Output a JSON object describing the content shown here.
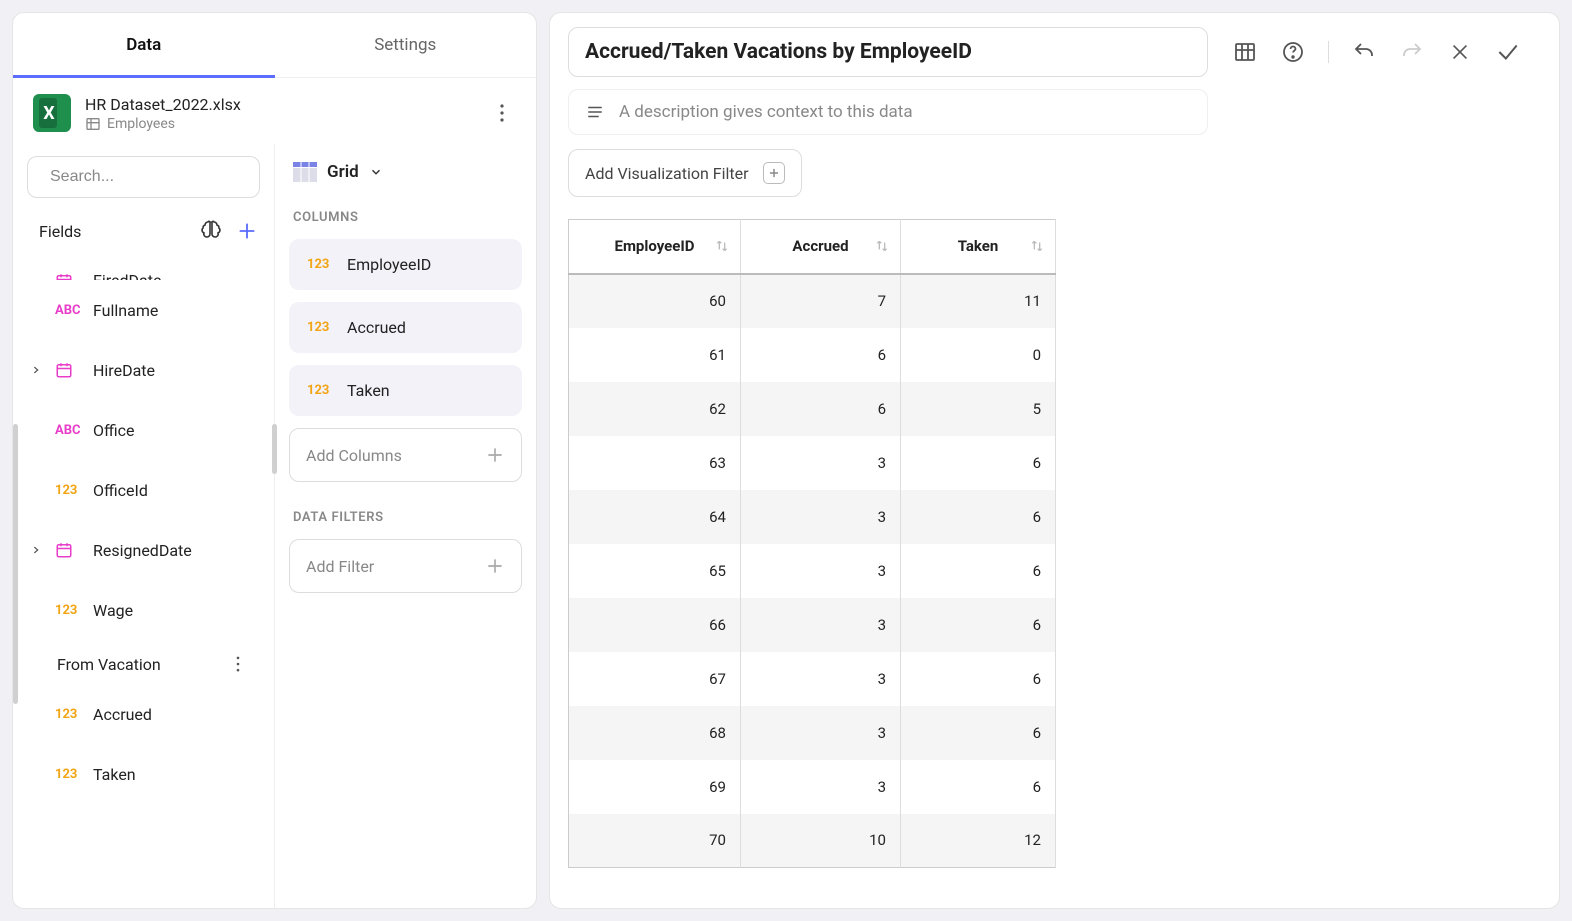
{
  "tabs": {
    "data": "Data",
    "settings": "Settings"
  },
  "datasource": {
    "title": "HR Dataset_2022.xlsx",
    "sheet": "Employees"
  },
  "search": {
    "placeholder": "Search..."
  },
  "fields": {
    "label": "Fields",
    "items": [
      {
        "name": "FiredDate",
        "type": "date",
        "expandable": true,
        "cutoff": true
      },
      {
        "name": "Fullname",
        "type": "abc",
        "expandable": false
      },
      {
        "name": "HireDate",
        "type": "date",
        "expandable": true
      },
      {
        "name": "Office",
        "type": "abc",
        "expandable": false
      },
      {
        "name": "OfficeId",
        "type": "123",
        "expandable": false
      },
      {
        "name": "ResignedDate",
        "type": "date",
        "expandable": true
      },
      {
        "name": "Wage",
        "type": "123",
        "expandable": false
      }
    ],
    "group2_label": "From Vacation",
    "group2_items": [
      {
        "name": "Accrued",
        "type": "123"
      },
      {
        "name": "Taken",
        "type": "123"
      }
    ]
  },
  "config": {
    "viz_label": "Grid",
    "columns_label": "COLUMNS",
    "columns": [
      {
        "name": "EmployeeID",
        "type": "123"
      },
      {
        "name": "Accrued",
        "type": "123"
      },
      {
        "name": "Taken",
        "type": "123"
      }
    ],
    "add_columns": "Add Columns",
    "filters_label": "DATA FILTERS",
    "add_filter": "Add Filter"
  },
  "viz": {
    "title": "Accrued/Taken Vacations by EmployeeID",
    "desc_placeholder": "A description gives context to this data",
    "filter_btn": "Add Visualization Filter",
    "headers": {
      "c1": "EmployeeID",
      "c2": "Accrued",
      "c3": "Taken"
    },
    "rows": [
      {
        "eid": "60",
        "acc": "7",
        "tak": "11"
      },
      {
        "eid": "61",
        "acc": "6",
        "tak": "0"
      },
      {
        "eid": "62",
        "acc": "6",
        "tak": "5"
      },
      {
        "eid": "63",
        "acc": "3",
        "tak": "6"
      },
      {
        "eid": "64",
        "acc": "3",
        "tak": "6"
      },
      {
        "eid": "65",
        "acc": "3",
        "tak": "6"
      },
      {
        "eid": "66",
        "acc": "3",
        "tak": "6"
      },
      {
        "eid": "67",
        "acc": "3",
        "tak": "6"
      },
      {
        "eid": "68",
        "acc": "3",
        "tak": "6"
      },
      {
        "eid": "69",
        "acc": "3",
        "tak": "6"
      },
      {
        "eid": "70",
        "acc": "10",
        "tak": "12"
      }
    ]
  }
}
